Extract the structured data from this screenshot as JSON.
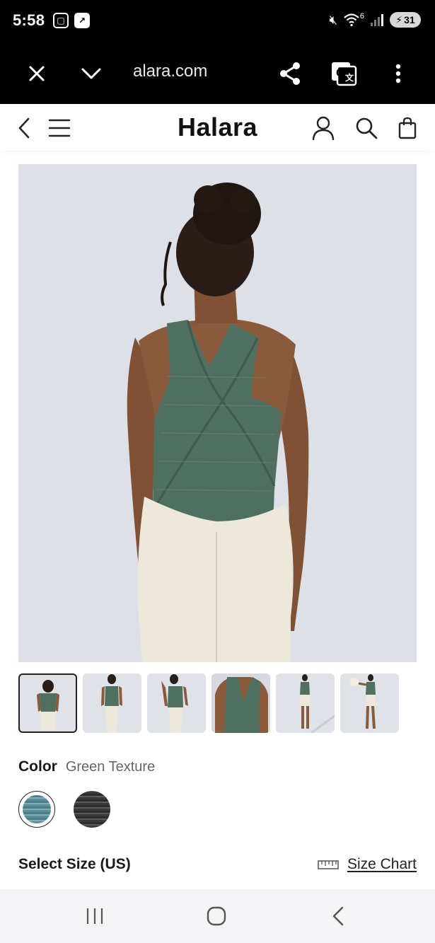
{
  "status_bar": {
    "time": "5:58",
    "signal_text": "6",
    "battery": "31"
  },
  "browser": {
    "url": "alara.com"
  },
  "site": {
    "brand": "Halara"
  },
  "product": {
    "color_label": "Color",
    "color_value": "Green Texture",
    "swatches": [
      {
        "name": "Green Texture",
        "color": "#5a8e98",
        "selected": true
      },
      {
        "name": "Dark Grey Texture",
        "color": "#3f3f3f",
        "selected": false
      }
    ],
    "size_label": "Select Size (US)",
    "size_chart_label": "Size Chart",
    "thumbnail_count": 6,
    "active_thumbnail": 1
  },
  "colors": {
    "tank_green": "#4f6f60",
    "background_photo": "#dde0e6",
    "skin": "#8a5a3c",
    "leggings": "#ece8dc"
  }
}
